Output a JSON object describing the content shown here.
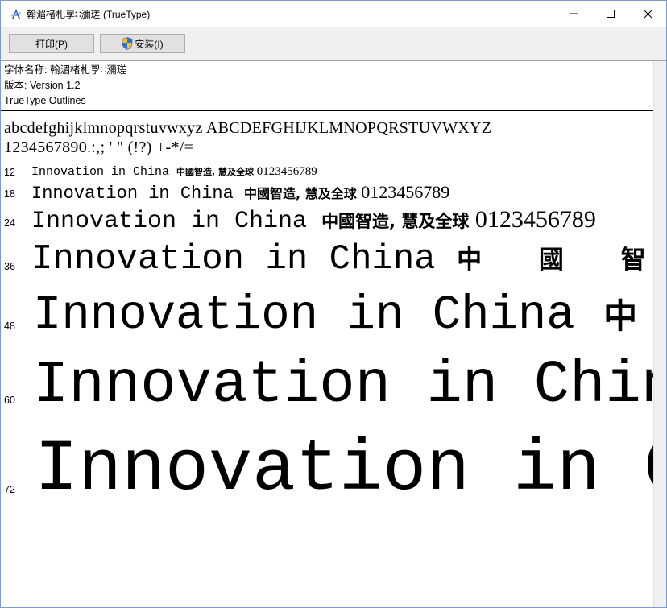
{
  "window": {
    "title": "翰湄楮札孠∷瀰瑳 (TrueType)"
  },
  "toolbar": {
    "print_label": "打印(P)",
    "install_label": "安装(I)"
  },
  "info": {
    "font_name": "字体名称: 翰湄楮札孠∷瀰瑳",
    "version": "版本: Version 1.2",
    "outlines": "TrueType Outlines"
  },
  "charset": {
    "line1": "abcdefghijklmnopqrstuvwxyz ABCDEFGHIJKLMNOPQRSTUVWXYZ",
    "line2": "1234567890.:,; ' \" (!?) +-*/="
  },
  "samples": [
    {
      "size": "12",
      "latin": "Innovation in China ",
      "cjk": "中國智造, 慧及全球",
      "digits": " 0123456789"
    },
    {
      "size": "18",
      "latin": "Innovation in China ",
      "cjk": "中國智造, 慧及全球",
      "digits": " 0123456789"
    },
    {
      "size": "24",
      "latin": "Innovation in China ",
      "cjk": "中國智造, 慧及全球",
      "digits": " 0123456789"
    },
    {
      "size": "36",
      "latin": "Innovation in China ",
      "cjk": "中 國 智",
      "digits": ""
    },
    {
      "size": "48",
      "latin": "Innovation in China ",
      "cjk": "中",
      "digits": ""
    },
    {
      "size": "60",
      "latin": "Innovation in Chin",
      "cjk": "",
      "digits": ""
    },
    {
      "size": "72",
      "latin": "Innovation in C",
      "cjk": "",
      "digits": ""
    }
  ]
}
